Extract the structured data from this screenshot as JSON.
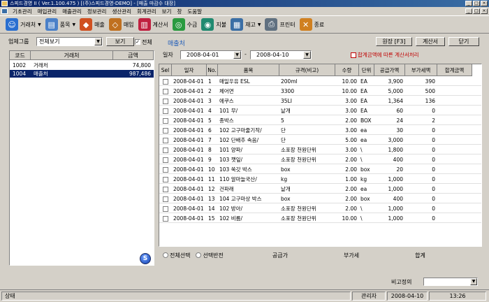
{
  "window": {
    "title": "스피드경영 II ( Ver.1.100.475 )    [(주)스피드경영-DEMO] - [매출 마감수 대장]"
  },
  "menu": [
    "기초관리",
    "매입관리",
    "매출관리",
    "정보관리",
    "생산관리",
    "회계관리",
    "보기",
    "창",
    "도움말"
  ],
  "toolbar": [
    {
      "label": "거래처",
      "icon": "people-icon",
      "dropdown": true,
      "color": "#2a6fd0"
    },
    {
      "label": "품목",
      "icon": "document-icon",
      "dropdown": true,
      "color": "#4a80c8"
    },
    {
      "label": "매출",
      "icon": "sales-icon",
      "dropdown": false,
      "color": "#d05020"
    },
    {
      "label": "매입",
      "icon": "purchase-icon",
      "dropdown": false,
      "color": "#c07020"
    },
    {
      "label": "계산서",
      "icon": "invoice-icon",
      "dropdown": false,
      "color": "#c02040"
    },
    {
      "label": "수금",
      "icon": "collect-icon",
      "dropdown": false,
      "color": "#2a9a40"
    },
    {
      "label": "지불",
      "icon": "payment-icon",
      "dropdown": false,
      "color": "#208a70"
    },
    {
      "label": "재고",
      "icon": "inventory-icon",
      "dropdown": true,
      "color": "#3a6ea5"
    },
    {
      "label": "프린터",
      "icon": "printer-icon",
      "dropdown": false,
      "color": "#607080"
    },
    {
      "label": "종료",
      "icon": "exit-icon",
      "dropdown": false,
      "color": "#d08020"
    }
  ],
  "left": {
    "filter_label": "업체그룹",
    "filter_value": "전체보기",
    "view_button": "보기",
    "all_label": "전체",
    "all_checked": true,
    "headers": [
      "코드",
      "거래처",
      "금액"
    ],
    "rows": [
      {
        "code": "1002",
        "name": "거래처",
        "amount": "74,800",
        "selected": false
      },
      {
        "code": "1004",
        "name": "매출처",
        "amount": "987,486",
        "selected": true
      }
    ]
  },
  "right": {
    "title": "매출처",
    "date_label": "일자",
    "date_from": "2008-04-01",
    "date_to": "2008-04-10",
    "tax_option": "합계금액에 따른 계산서처리",
    "buttons": {
      "write": "원장 [F3]",
      "calc": "계산서",
      "close": "닫기"
    },
    "headers": [
      "Sel",
      "일자",
      "No.",
      "품목",
      "규격(비고)",
      "수량",
      "단위",
      "공급가액",
      "부가세액",
      "합계금액"
    ],
    "rows": [
      {
        "date": "2008-04-01",
        "no": "1",
        "item": "매일우유 ESL",
        "spec": "200ml",
        "qty": "10.00",
        "unit": "EA",
        "supply": "3,900",
        "vat": "390",
        "total": ""
      },
      {
        "date": "2008-04-01",
        "no": "2",
        "item": "체어면",
        "spec": "3300",
        "qty": "10.00",
        "unit": "EA",
        "supply": "5,000",
        "vat": "500",
        "total": ""
      },
      {
        "date": "2008-04-01",
        "no": "3",
        "item": "에쿠스",
        "spec": "35LI",
        "qty": "3.00",
        "unit": "EA",
        "supply": "1,364",
        "vat": "136",
        "total": ""
      },
      {
        "date": "2008-04-01",
        "no": "4",
        "item": "101 무/",
        "spec": "낱개",
        "qty": "3.00",
        "unit": "EA",
        "supply": "60",
        "vat": "0",
        "total": ""
      },
      {
        "date": "2008-04-01",
        "no": "5",
        "item": "종박스",
        "spec": "5",
        "qty": "2.00",
        "unit": "BOX",
        "supply": "24",
        "vat": "2",
        "total": ""
      },
      {
        "date": "2008-04-01",
        "no": "6",
        "item": "102 고구마줄기작/",
        "spec": "단",
        "qty": "3.00",
        "unit": "ea",
        "supply": "30",
        "vat": "0",
        "total": ""
      },
      {
        "date": "2008-04-01",
        "no": "7",
        "item": "102 단배추 속음/",
        "spec": "단",
        "qty": "5.00",
        "unit": "ea",
        "supply": "3,000",
        "vat": "0",
        "total": ""
      },
      {
        "date": "2008-04-01",
        "no": "8",
        "item": "101 양파/",
        "spec": "소포장 천원단위",
        "qty": "3.00",
        "unit": "\\",
        "supply": "1,800",
        "vat": "0",
        "total": ""
      },
      {
        "date": "2008-04-01",
        "no": "9",
        "item": "103 깻잎/",
        "spec": "소포장 천원단위",
        "qty": "2.00",
        "unit": "\\",
        "supply": "400",
        "vat": "0",
        "total": ""
      },
      {
        "date": "2008-04-01",
        "no": "10",
        "item": "103 쑥갓 박스",
        "spec": "box",
        "qty": "2.00",
        "unit": "box",
        "supply": "20",
        "vat": "0",
        "total": ""
      },
      {
        "date": "2008-04-01",
        "no": "11",
        "item": "110 알마늘국산/",
        "spec": "kg",
        "qty": "1.00",
        "unit": "kg",
        "supply": "1,000",
        "vat": "0",
        "total": ""
      },
      {
        "date": "2008-04-01",
        "no": "12",
        "item": "건파래",
        "spec": "낱개",
        "qty": "2.00",
        "unit": "ea",
        "supply": "1,000",
        "vat": "0",
        "total": ""
      },
      {
        "date": "2008-04-01",
        "no": "13",
        "item": "104 고구마상 박스",
        "spec": "box",
        "qty": "2.00",
        "unit": "box",
        "supply": "400",
        "vat": "0",
        "total": ""
      },
      {
        "date": "2008-04-01",
        "no": "14",
        "item": "102 방아/",
        "spec": "소포장 천원단위",
        "qty": "2.00",
        "unit": "\\",
        "supply": "1,000",
        "vat": "0",
        "total": ""
      },
      {
        "date": "2008-04-01",
        "no": "15",
        "item": "102 비름/",
        "spec": "소포장 천원단위",
        "qty": "10.00",
        "unit": "\\",
        "supply": "1,000",
        "vat": "0",
        "total": ""
      }
    ],
    "footer": {
      "select_all": "전체선택",
      "invert": "선택반전",
      "supply": "공급가",
      "vat": "부가세",
      "total": "합계"
    }
  },
  "bottom": {
    "memo_label": "비고정의",
    "memo_value": ""
  },
  "status": {
    "state": "상태",
    "user": "관리자",
    "date": "2008-04-10",
    "time": "13:26"
  }
}
